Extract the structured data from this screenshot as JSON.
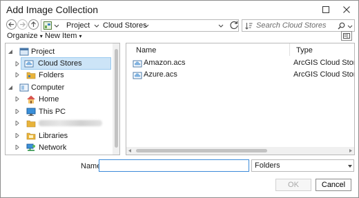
{
  "window": {
    "title": "Add Image Collection"
  },
  "address_bar": {
    "crumbs": [
      "Project",
      "Cloud Stores"
    ],
    "search_placeholder": "Search Cloud Stores"
  },
  "toolbar": {
    "organize_label": "Organize",
    "new_item_label": "New Item"
  },
  "tree": {
    "items": [
      {
        "label": "Project",
        "icon": "project-icon",
        "level": 0,
        "expanded": true
      },
      {
        "label": "Cloud Stores",
        "icon": "cloud-store-icon",
        "level": 1,
        "selected": true
      },
      {
        "label": "Folders",
        "icon": "folders-icon",
        "level": 1
      },
      {
        "label": "Computer",
        "icon": "computer-icon",
        "level": 0,
        "expanded": true
      },
      {
        "label": "Home",
        "icon": "home-icon",
        "level": 1
      },
      {
        "label": "This PC",
        "icon": "monitor-icon",
        "level": 1
      },
      {
        "label": "",
        "icon": "folder-icon",
        "level": 1,
        "blurred": true
      },
      {
        "label": "Libraries",
        "icon": "libraries-icon",
        "level": 1
      },
      {
        "label": "Network",
        "icon": "network-icon",
        "level": 1
      }
    ]
  },
  "file_list": {
    "columns": [
      "Name",
      "Type"
    ],
    "rows": [
      {
        "name": "Amazon.acs",
        "type": "ArcGIS Cloud Storage Connection",
        "icon": "cloud-connection-icon"
      },
      {
        "name": "Azure.acs",
        "type": "ArcGIS Cloud Storage Connection",
        "icon": "cloud-connection-icon"
      }
    ]
  },
  "bottom": {
    "name_label": "Name",
    "name_value": "",
    "type_filter": "Folders",
    "ok_label": "OK",
    "cancel_label": "Cancel"
  },
  "colors": {
    "selection": "#cce4f7",
    "selection_border": "#99c9ef",
    "input_focus": "#3b8ad9",
    "folder": "#e8b33b"
  }
}
